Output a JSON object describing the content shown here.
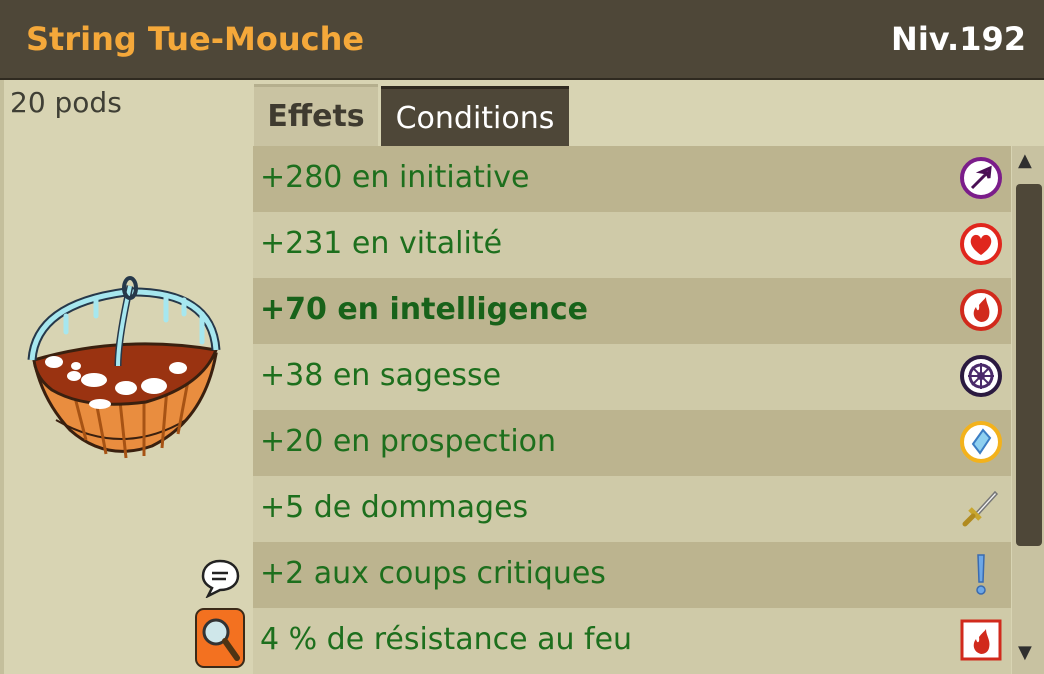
{
  "header": {
    "item_name": "String Tue-Mouche",
    "level": "Niv.192"
  },
  "left_panel": {
    "weight": "20 pods"
  },
  "tabs": [
    {
      "label": "Effets",
      "active": true
    },
    {
      "label": "Conditions",
      "active": false
    }
  ],
  "effects": [
    {
      "text": "+280 en initiative",
      "icon": "initiative-arrow-icon",
      "bold": false
    },
    {
      "text": "+231 en vitalité",
      "icon": "vitality-heart-icon",
      "bold": false
    },
    {
      "text": "+70 en intelligence",
      "icon": "intelligence-flame-icon",
      "bold": true
    },
    {
      "text": "+38 en sagesse",
      "icon": "wisdom-wheel-icon",
      "bold": false
    },
    {
      "text": "+20 en prospection",
      "icon": "prospection-gem-icon",
      "bold": false
    },
    {
      "text": "+5 de dommages",
      "icon": "damage-sword-icon",
      "bold": false
    },
    {
      "text": "+2 aux coups critiques",
      "icon": "critical-exclamation-icon",
      "bold": false
    },
    {
      "text": "4 % de résistance au feu",
      "icon": "fire-resistance-icon",
      "bold": false
    }
  ],
  "colors": {
    "header_bg": "#4e4738",
    "item_name": "#f4a83a",
    "effect_text": "#1d6f1d"
  }
}
